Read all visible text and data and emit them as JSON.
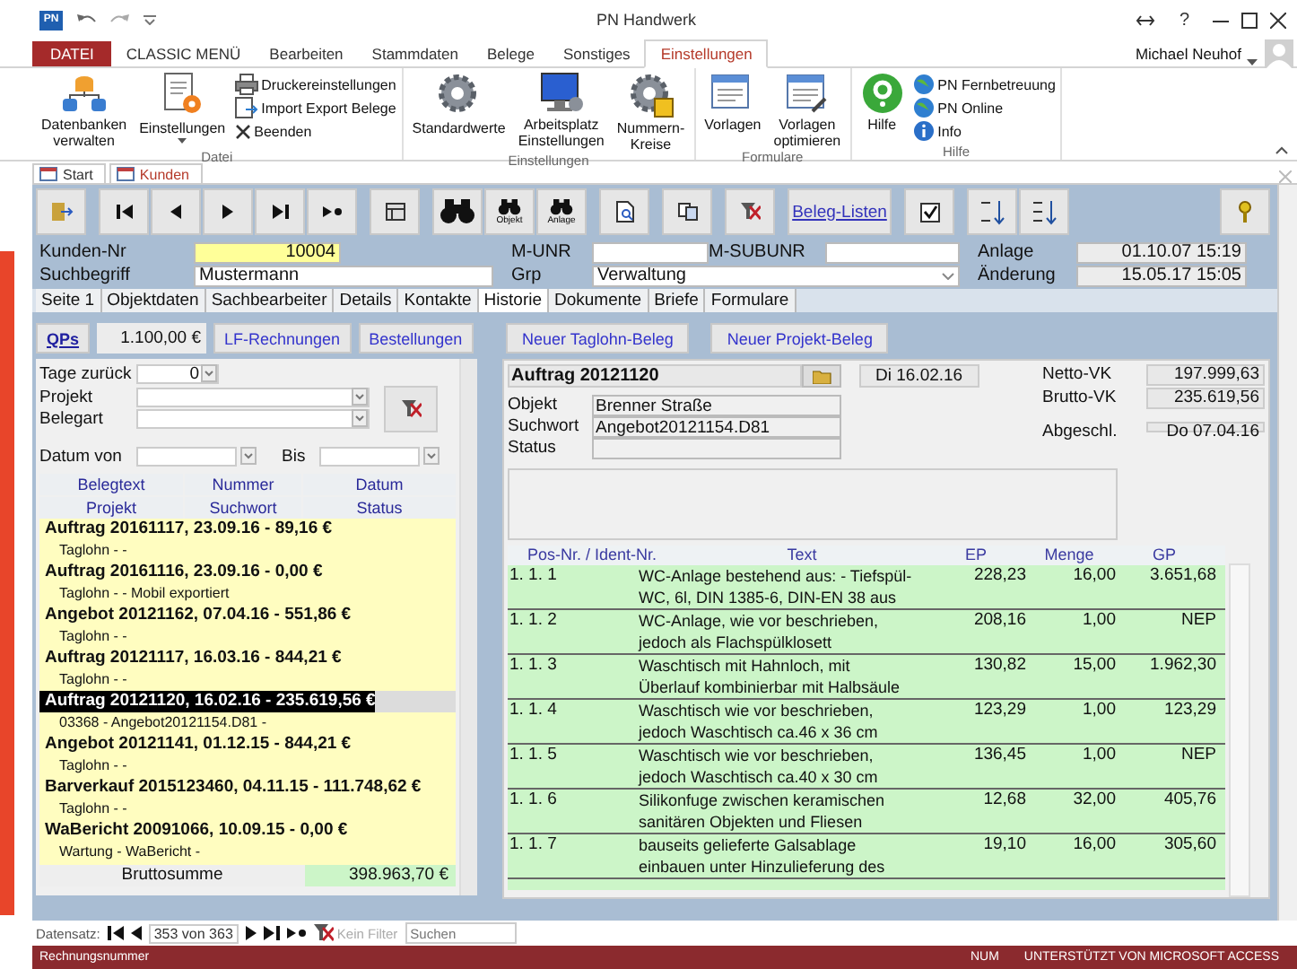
{
  "window": {
    "app_badge": "PN",
    "title": "PN Handwerk",
    "help": "?",
    "user": "Michael Neuhof"
  },
  "ribbon": {
    "tabs": [
      {
        "label": "DATEI",
        "kind": "file",
        "selected": false
      },
      {
        "label": "CLASSIC MENÜ",
        "kind": "tab",
        "selected": false
      },
      {
        "label": "Bearbeiten",
        "kind": "tab",
        "selected": false
      },
      {
        "label": "Stammdaten",
        "kind": "tab",
        "selected": false
      },
      {
        "label": "Belege",
        "kind": "tab",
        "selected": false
      },
      {
        "label": "Sonstiges",
        "kind": "tab",
        "selected": false
      },
      {
        "label": "Einstellungen",
        "kind": "tab",
        "selected": true
      }
    ],
    "groups": [
      {
        "label": "Datei",
        "items": [
          {
            "label": "Datenbanken\nverwalten",
            "kind": "large",
            "dropdown": false
          },
          {
            "label": "Einstellungen",
            "kind": "large",
            "dropdown": true
          },
          {
            "label": "Druckereinstellungen",
            "kind": "small",
            "dropdown": false
          },
          {
            "label": "Import Export Belege",
            "kind": "small",
            "dropdown": false
          },
          {
            "label": "Beenden",
            "kind": "small",
            "dropdown": false
          }
        ]
      },
      {
        "label": "Einstellungen",
        "items": [
          {
            "label": "Standardwerte",
            "kind": "large",
            "dropdown": false
          },
          {
            "label": "Arbeitsplatz\nEinstellungen",
            "kind": "large",
            "dropdown": false
          },
          {
            "label": "Nummern-\nKreise",
            "kind": "large",
            "dropdown": false
          }
        ]
      },
      {
        "label": "Formulare",
        "items": [
          {
            "label": "Vorlagen",
            "kind": "large",
            "dropdown": false
          },
          {
            "label": "Vorlagen\noptimieren",
            "kind": "large",
            "dropdown": false
          }
        ]
      },
      {
        "label": "Hilfe",
        "items": [
          {
            "label": "Hilfe",
            "kind": "large",
            "dropdown": false
          },
          {
            "label": "PN Fernbetreuung",
            "kind": "small",
            "dropdown": false
          },
          {
            "label": "PN Online",
            "kind": "small",
            "dropdown": false
          },
          {
            "label": "Info",
            "kind": "small",
            "dropdown": false
          }
        ]
      }
    ]
  },
  "document_tabs": [
    {
      "label": "Start",
      "selected": false
    },
    {
      "label": "Kunden",
      "selected": true
    }
  ],
  "toolbar": {
    "objekt": "Objekt",
    "anlage": "Anlage",
    "beleg_listen": "Beleg-Listen"
  },
  "customer": {
    "kunden_nr_label": "Kunden-Nr",
    "kunden_nr": "10004",
    "suchbegriff_label": "Suchbegriff",
    "suchbegriff": "Mustermann",
    "m_unr_label": "M-UNR",
    "m_subunr_label": "M-SUBUNR",
    "grp_label": "Grp",
    "grp": "Verwaltung",
    "anlage_label": "Anlage",
    "anlage": "01.10.07 15:19",
    "aenderung_label": "Änderung",
    "aenderung": "15.05.17 15:05"
  },
  "page_tabs": [
    {
      "label": "Seite 1",
      "selected": false
    },
    {
      "label": "Objektdaten",
      "selected": false
    },
    {
      "label": "Sachbearbeiter",
      "selected": false
    },
    {
      "label": "Details",
      "selected": false
    },
    {
      "label": "Kontakte",
      "selected": false
    },
    {
      "label": "Historie",
      "selected": true
    },
    {
      "label": "Dokumente",
      "selected": false
    },
    {
      "label": "Briefe",
      "selected": false
    },
    {
      "label": "Formulare",
      "selected": false
    }
  ],
  "history": {
    "qps": "QPs",
    "qps_amount": "1.100,00 €",
    "lf_rechnungen": "LF-Rechnungen",
    "bestellungen": "Bestellungen",
    "filters": {
      "tage_label": "Tage zurück",
      "tage": "0",
      "projekt_label": "Projekt",
      "belegart_label": "Belegart",
      "datum_von_label": "Datum von",
      "bis_label": "Bis"
    },
    "columns": [
      "Belegtext",
      "Nummer",
      "Datum",
      "Projekt",
      "Suchwort",
      "Status"
    ],
    "entries": [
      {
        "title": "Auftrag 20161117, 23.09.16 - 89,16 €",
        "sub": "Taglohn -  -",
        "selected": false
      },
      {
        "title": "Auftrag 20161116, 23.09.16 - 0,00 €",
        "sub": "Taglohn -  - Mobil exportiert",
        "selected": false
      },
      {
        "title": "Angebot 20121162, 07.04.16 - 551,86 €",
        "sub": "Taglohn -  -",
        "selected": false
      },
      {
        "title": "Auftrag 20121117, 16.03.16 - 844,21 €",
        "sub": "Taglohn -  -",
        "selected": false
      },
      {
        "title": "Auftrag 20121120, 16.02.16 - 235.619,56 €",
        "sub": "03368 - Angebot20121154.D81 -",
        "selected": true
      },
      {
        "title": "Angebot 20121141, 01.12.15 - 844,21 €",
        "sub": "Taglohn -  -",
        "selected": false
      },
      {
        "title": "Barverkauf 2015123460, 04.11.15 - 111.748,62 €",
        "sub": "Taglohn -  -",
        "selected": false
      },
      {
        "title": "WaBericht 20091066, 10.09.15 - 0,00 €",
        "sub": "Wartung - WaBericht -",
        "selected": false
      }
    ],
    "sum_label": "Bruttosumme",
    "sum": "398.963,70 €"
  },
  "document": {
    "neuer_taglohn": "Neuer Taglohn-Beleg",
    "neuer_projekt": "Neuer Projekt-Beleg",
    "title": "Auftrag 20121120",
    "date": "Di 16.02.16",
    "objekt_label": "Objekt",
    "objekt": "Brenner Straße",
    "suchwort_label": "Suchwort",
    "suchwort": "Angebot20121154.D81",
    "status_label": "Status",
    "netto_label": "Netto-VK",
    "netto": "197.999,63",
    "brutto_label": "Brutto-VK",
    "brutto": "235.619,56",
    "abgeschl_label": "Abgeschl.",
    "abgeschl": "Do 07.04.16",
    "columns": [
      "Pos-Nr. / Ident-Nr.",
      "Text",
      "EP",
      "Menge",
      "GP"
    ],
    "rows": [
      {
        "pos": "1. 1. 1",
        "text": "WC-Anlage bestehend aus: - Tiefspül-\nWC, 6l, DIN 1385-6, DIN-EN 38 aus",
        "ep": "228,23",
        "menge": "16,00",
        "gp": "3.651,68"
      },
      {
        "pos": "1. 1. 2",
        "text": "WC-Anlage, wie vor beschrieben,\njedoch als Flachspülklosett",
        "ep": "208,16",
        "menge": "1,00",
        "gp": "NEP"
      },
      {
        "pos": "1. 1. 3",
        "text": "Waschtisch mit Hahnloch, mit\nÜberlauf kombinierbar mit Halbsäule",
        "ep": "130,82",
        "menge": "15,00",
        "gp": "1.962,30"
      },
      {
        "pos": "1. 1. 4",
        "text": "Waschtisch wie vor beschrieben,\njedoch Waschtisch ca.46 x 36 cm",
        "ep": "123,29",
        "menge": "1,00",
        "gp": "123,29"
      },
      {
        "pos": "1. 1. 5",
        "text": "Waschtisch wie vor beschrieben,\njedoch Waschtisch ca.40 x 30 cm",
        "ep": "136,45",
        "menge": "1,00",
        "gp": "NEP"
      },
      {
        "pos": "1. 1. 6",
        "text": "Silikonfuge zwischen keramischen\nsanitären Objekten und Fliesen",
        "ep": "12,68",
        "menge": "32,00",
        "gp": "405,76"
      },
      {
        "pos": "1. 1. 7",
        "text": "bauseits gelieferte Galsablage\neinbauen unter Hinzulieferung des",
        "ep": "19,10",
        "menge": "16,00",
        "gp": "305,60"
      }
    ]
  },
  "record_navigator": {
    "label": "Datensatz:",
    "position": "353 von 363",
    "filter": "Kein Filter",
    "filter_disabled": true,
    "search_placeholder": "Suchen"
  },
  "status_bar": {
    "left": "Rechnungsnummer",
    "num": "NUM",
    "right": "UNTERSTÜTZT VON MICROSOFT ACCESS"
  }
}
